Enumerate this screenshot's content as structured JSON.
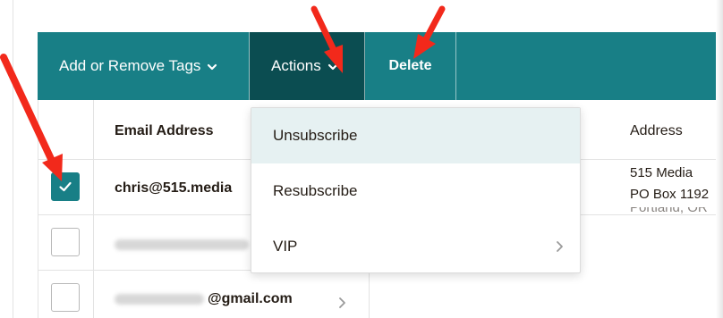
{
  "toolbar": {
    "tags_label": "Add or Remove Tags",
    "actions_label": "Actions",
    "delete_label": "Delete",
    "color": "#187f86",
    "active_color": "#0b4d51"
  },
  "table": {
    "email_header": "Email Address",
    "address_header": "Address",
    "rows": [
      {
        "checked": true,
        "email": "chris@515.media",
        "address_lines": [
          "515 Media",
          "PO Box 1192"
        ],
        "partial_text": "n"
      },
      {
        "checked": false,
        "email": ""
      },
      {
        "checked": false,
        "email_suffix": "@gmail.com"
      }
    ]
  },
  "actions_menu": {
    "items": [
      {
        "label": "Unsubscribe",
        "highlighted": true
      },
      {
        "label": "Resubscribe",
        "highlighted": false
      },
      {
        "label": "VIP",
        "has_submenu": true
      }
    ]
  },
  "annotations": {
    "arrow_color": "#f2291b",
    "count": 3
  }
}
